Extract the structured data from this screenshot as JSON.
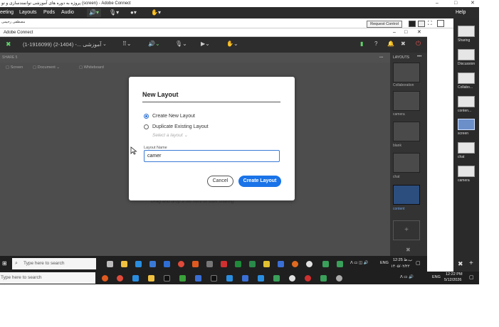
{
  "outer_window": {
    "title": "پروژه به دوره های آموزشی توانمندسازی و تو (screen) - Adobe Connect",
    "menu": [
      "eeting",
      "Layouts",
      "Pods",
      "Audio"
    ],
    "help_label": "Help",
    "request_control_label": "Request Control",
    "subtitle_rtl": "مصطفی رحیمی"
  },
  "right_panel": {
    "items": [
      {
        "label": "Sharing"
      },
      {
        "label": "Discussion"
      },
      {
        "label": "Collabo..."
      },
      {
        "label": "conten..."
      },
      {
        "label": "screen"
      },
      {
        "label": "chat"
      },
      {
        "label": "camera"
      }
    ]
  },
  "inner_window": {
    "title": "Adobe Connect",
    "meeting_name": "(1-1916099) (2-1404) -... آموزشی",
    "share_label": "SHARE 5",
    "tabs": [
      "Screen",
      "Document",
      "Whiteboard"
    ],
    "drag_hint": "Drag and drop a file here to start sharing"
  },
  "layouts_panel": {
    "header": "LAYOUTS",
    "items": [
      "Collaboration",
      "camera",
      "blank",
      "chat",
      "content"
    ]
  },
  "dialog": {
    "title": "New Layout",
    "option_create": "Create New Layout",
    "option_duplicate": "Duplicate Existing Layout",
    "select_placeholder": "Select a layout",
    "name_label": "Layout Name",
    "name_value": "camer",
    "cancel_label": "Cancel",
    "create_label": "Create Layout",
    "selected_option": "create"
  },
  "inner_taskbar": {
    "search_placeholder": "Type here to search",
    "lang": "ENG",
    "time": "12:25 ب.ظ",
    "date": "۱۴۰۵/۰۲/۲۲"
  },
  "outer_taskbar": {
    "search_placeholder": "Type here to search",
    "lang": "ENG",
    "time": "12:22 PM",
    "date": "5/12/2026"
  },
  "colors": {
    "accent": "#1a73e8",
    "dark_bar": "#2d2d2d",
    "stage": "#5a5a5a"
  }
}
